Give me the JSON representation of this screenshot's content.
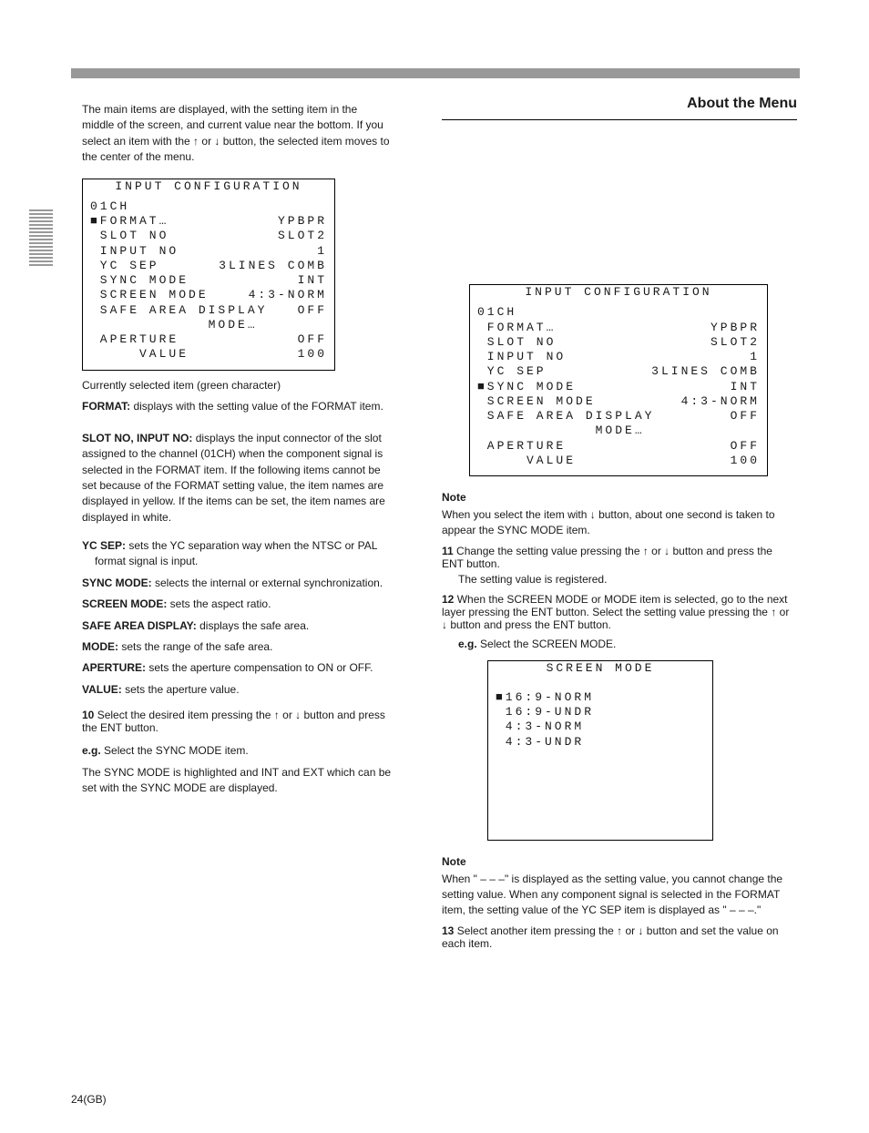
{
  "header_rule": true,
  "page_footer": "24(GB)",
  "left": {
    "intro_para": "The main items are displayed, with the setting item in the middle of the screen, and current value near the bottom. If you select an item with the ↑ or ↓ button, the selected item moves to the center of the menu.",
    "menu": {
      "title": "INPUT CONFIGURATION",
      "channel": "01CH",
      "rows": [
        {
          "label": "■FORMAT…",
          "value": "YPBPR"
        },
        {
          "label": " SLOT NO",
          "value": "SLOT2"
        },
        {
          "label": " INPUT NO",
          "value": "1"
        },
        {
          "label": " YC SEP",
          "value": "3LINES COMB"
        },
        {
          "label": " SYNC MODE",
          "value": "INT"
        },
        {
          "label": " SCREEN MODE",
          "value": "4:3-NORM"
        },
        {
          "label": " SAFE AREA DISPLAY",
          "value": "OFF"
        },
        {
          "label": "            MODE…",
          "value": ""
        },
        {
          "label": " APERTURE",
          "value": "OFF"
        },
        {
          "label": "     VALUE",
          "value": "100"
        }
      ]
    },
    "co_sel": "Currently selected item (green character)",
    "explain_row_label": "FORMAT:",
    "explain_row_text": "displays with the setting value of the FORMAT item.",
    "explain_row2_label": "SLOT NO, INPUT NO:",
    "explain_row2_text": "",
    "explain_row2_cont": "displays the input connector of the slot assigned to the channel (01CH) when the component signal is selected in the FORMAT item. If the following items cannot be set because of the FORMAT setting value, the item names are displayed in yellow. If the items can be set, the item names are displayed in white.",
    "items": [
      {
        "label": "YC SEP:",
        "text": "sets the YC separation way when the NTSC or PAL format signal is input."
      },
      {
        "label": "SYNC MODE:",
        "text": "selects the internal or external synchronization."
      },
      {
        "label": "SCREEN MODE:",
        "text": "sets the aspect ratio."
      },
      {
        "label": "SAFE AREA DISPLAY:",
        "text": "displays the safe area."
      },
      {
        "label": "MODE:",
        "text": "sets the range of the safe area."
      },
      {
        "label": "APERTURE:",
        "text": "sets the aperture compensation to ON or OFF."
      },
      {
        "label": "VALUE:",
        "text": "sets the aperture value."
      }
    ],
    "step10_heading": "10",
    "step10_body": "Select the desired item pressing the ↑ or ↓ button and press the ENT button.",
    "eg_label": "e.g.",
    "eg_text": "Select the SYNC MODE item.",
    "eg_text2": "The SYNC MODE is highlighted and INT and EXT which can be set with the SYNC MODE are displayed."
  },
  "right": {
    "section_title": "About the Menu",
    "menu": {
      "title": "INPUT CONFIGURATION",
      "channel": "01CH",
      "rows": [
        {
          "label": " FORMAT…",
          "value": "YPBPR"
        },
        {
          "label": " SLOT NO",
          "value": "SLOT2"
        },
        {
          "label": " INPUT NO",
          "value": "1"
        },
        {
          "label": " YC SEP",
          "value": "3LINES COMB"
        },
        {
          "label": "■SYNC MODE",
          "value": "INT"
        },
        {
          "label": " SCREEN MODE",
          "value": "4:3-NORM"
        },
        {
          "label": " SAFE AREA DISPLAY",
          "value": "OFF"
        },
        {
          "label": "            MODE…",
          "value": ""
        },
        {
          "label": " APERTURE",
          "value": "OFF"
        },
        {
          "label": "     VALUE",
          "value": "100"
        }
      ]
    },
    "note1_title": "Note",
    "note1_body": "When you select the item with ↓ button, about one second is taken to appear the SYNC MODE item.",
    "step11_heading": "11",
    "step11_body": "Change the setting value pressing the ↑ or ↓ button and press the ENT button.",
    "step11_after": "The setting value is registered.",
    "step12_heading": "12",
    "step12_body": "When the SCREEN MODE or MODE item is selected, go to the next layer pressing the ENT button. Select the setting value pressing the ↑ or ↓ button and press the ENT button.",
    "eg_label": "e.g.",
    "eg_text": "Select the SCREEN MODE.",
    "screen_mode": {
      "title": "SCREEN MODE",
      "options": [
        "■16:9-NORM",
        " 16:9-UNDR",
        " 4:3-NORM",
        " 4:3-UNDR"
      ]
    },
    "note2_title": "Note",
    "note2_body": "When \" – – –\" is displayed as the setting value, you cannot change the setting value. When any component signal is selected in the FORMAT item, the setting value of the YC SEP item is displayed as \" – – –.\"",
    "step13_heading": "13",
    "step13_body": "Select another item pressing the ↑ or ↓ button and set the value on each item."
  }
}
